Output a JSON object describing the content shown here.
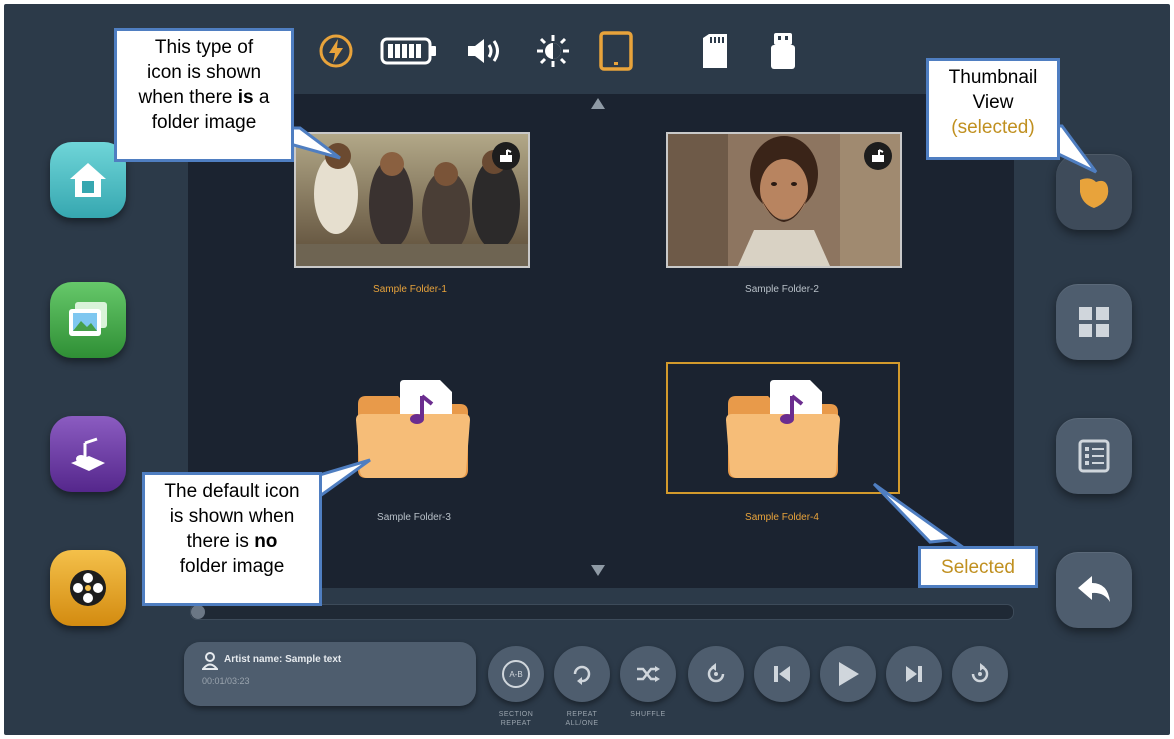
{
  "status_bar": {
    "icons": [
      "charging-icon",
      "battery-icon",
      "volume-icon",
      "brightness-icon",
      "tablet-icon",
      "sd-card-icon",
      "usb-drive-icon"
    ],
    "accent": "#e8a33b"
  },
  "left_nav": {
    "items": [
      {
        "name": "home",
        "color": "#4cc3c9"
      },
      {
        "name": "photos",
        "color": "#4aa84f"
      },
      {
        "name": "music",
        "color": "#6b3aa0"
      },
      {
        "name": "video",
        "color": "#e7a21a"
      }
    ]
  },
  "folders": [
    {
      "label": "Sample Folder-1",
      "has_image": true,
      "selected": false
    },
    {
      "label": "Sample Folder-2",
      "has_image": true,
      "selected": false
    },
    {
      "label": "Sample Folder-3",
      "has_image": false,
      "selected": false
    },
    {
      "label": "Sample Folder-4",
      "has_image": false,
      "selected": true
    }
  ],
  "right_nav": {
    "items": [
      "thumbnail-view",
      "grid-view",
      "list-view",
      "back"
    ],
    "selected": "thumbnail-view"
  },
  "player": {
    "artist_line": "Artist name: Sample text",
    "time": "00:01/03:23",
    "section_repeat_label": "SECTION REPEAT",
    "repeat_label": "REPEAT ALL/ONE",
    "shuffle_label": "SHUFFLE",
    "section_repeat_text": "A-B"
  },
  "callouts": {
    "folder_image": {
      "line1": "This type of",
      "line2": "icon is shown",
      "line3_pre": "when there ",
      "line3_bold": "is",
      "line3_post": " a",
      "line4": "folder image"
    },
    "default_icon": {
      "line1": "The default icon",
      "line2": "is shown when",
      "line3_pre": "there is ",
      "line3_bold": "no",
      "line4": "folder image"
    },
    "thumbnail": {
      "line1": "Thumbnail",
      "line2": "View",
      "line3": "(selected)"
    },
    "selected": {
      "text": "Selected"
    }
  },
  "colors": {
    "frame": "#2c3a49",
    "panel": "#1b2330",
    "accent": "#e8a33b",
    "callout_border": "#4f7ec1",
    "callout_accent": "#c09020"
  }
}
